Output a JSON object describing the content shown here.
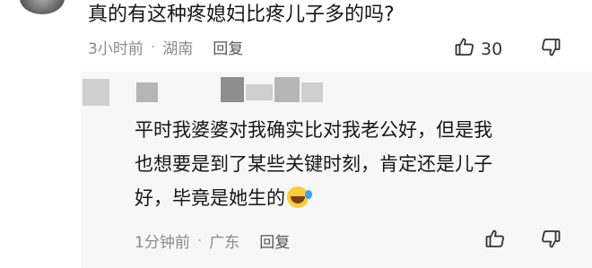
{
  "comment": {
    "text": "真的有这种疼媳妇比疼儿子多的吗?",
    "time": "3小时前",
    "location": "湖南",
    "reply_label": "回复",
    "likes": "30"
  },
  "reply": {
    "text_lines": [
      "平时我婆婆对我确实比对我老公好，但是我",
      "也想要是到了某些关键时刻，肯定还是儿子",
      "好，毕竟是她生的"
    ],
    "time": "1分钟前",
    "location": "广东",
    "reply_label": "回复"
  },
  "icons": {
    "like": "thumbs-up-icon",
    "dislike": "thumbs-down-icon",
    "laughing_emoji": "laughing-crying-emoji"
  }
}
